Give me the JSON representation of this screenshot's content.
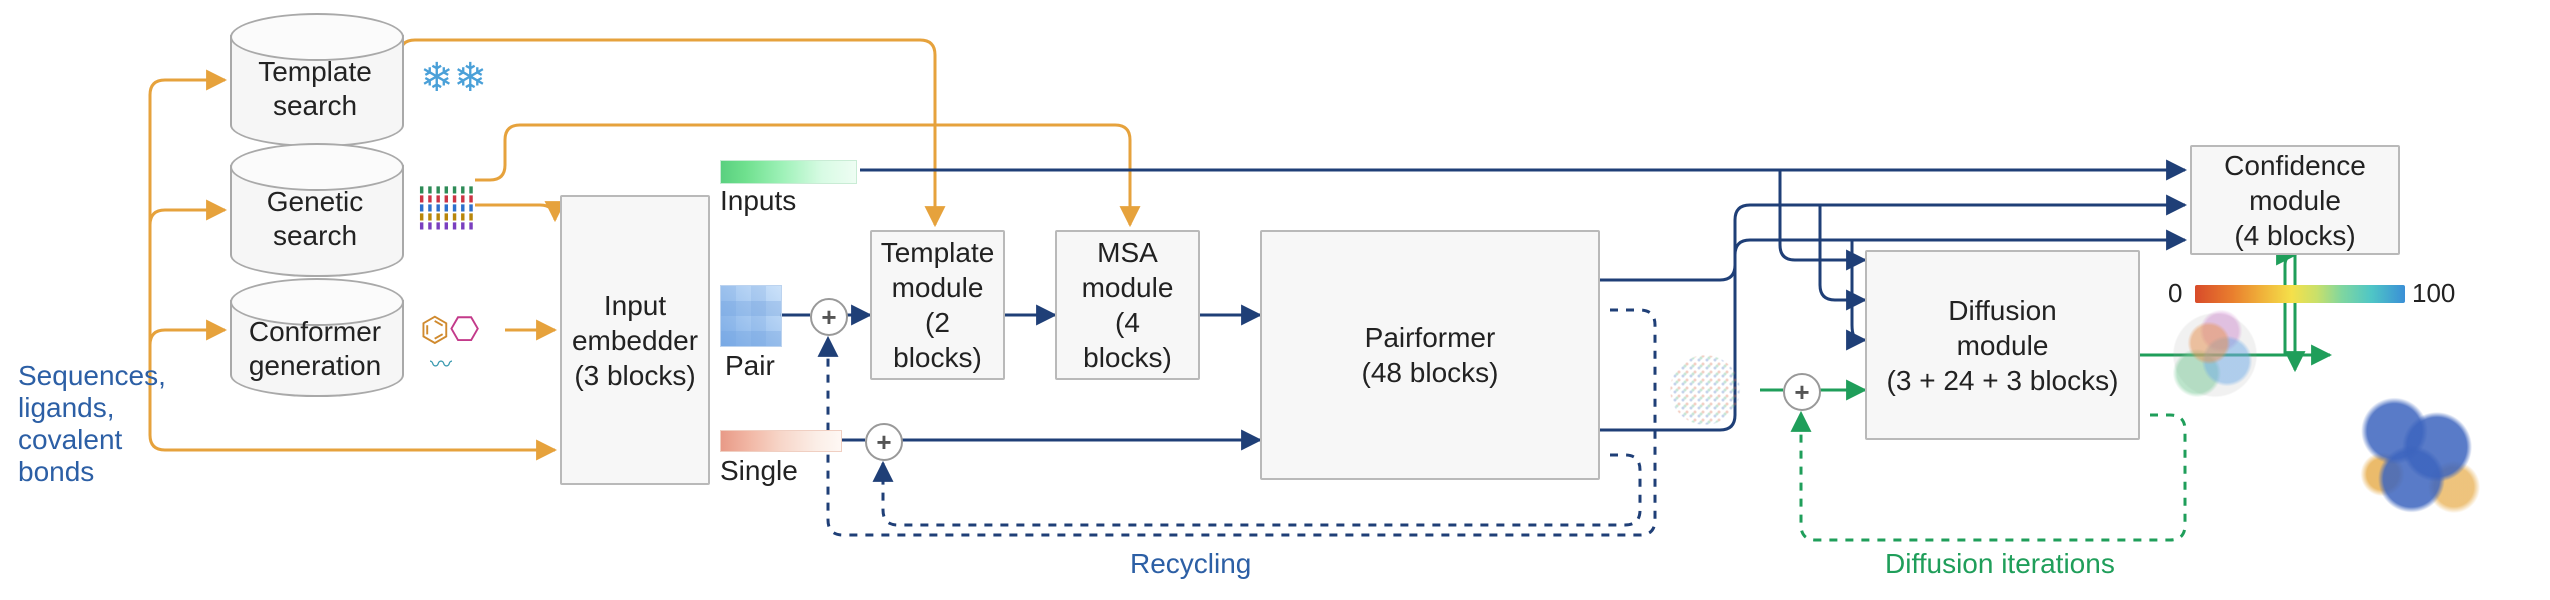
{
  "input_label": "Sequences,\nligands,\ncovalent\nbonds",
  "cylinders": {
    "template_search": "Template\nsearch",
    "genetic_search": "Genetic\nsearch",
    "conformer_generation": "Conformer\ngeneration"
  },
  "blocks": {
    "input_embedder": "Input\nembedder\n(3 blocks)",
    "template_module": "Template\nmodule\n(2 blocks)",
    "msa_module": "MSA\nmodule\n(4 blocks)",
    "pairformer": "Pairformer\n(48 blocks)",
    "diffusion_module": "Diffusion\nmodule\n(3 + 24 + 3 blocks)",
    "confidence_module": "Confidence\nmodule\n(4 blocks)"
  },
  "reps": {
    "inputs": "Inputs",
    "pair": "Pair",
    "single": "Single"
  },
  "loops": {
    "recycling": "Recycling",
    "diffusion_iterations": "Diffusion iterations"
  },
  "confidence_scale": {
    "min": "0",
    "max": "100"
  },
  "colors": {
    "orange": "#e6a23c",
    "navy": "#1f3f77",
    "green": "#1f9e5a",
    "blue_text": "#2c5fa5"
  }
}
